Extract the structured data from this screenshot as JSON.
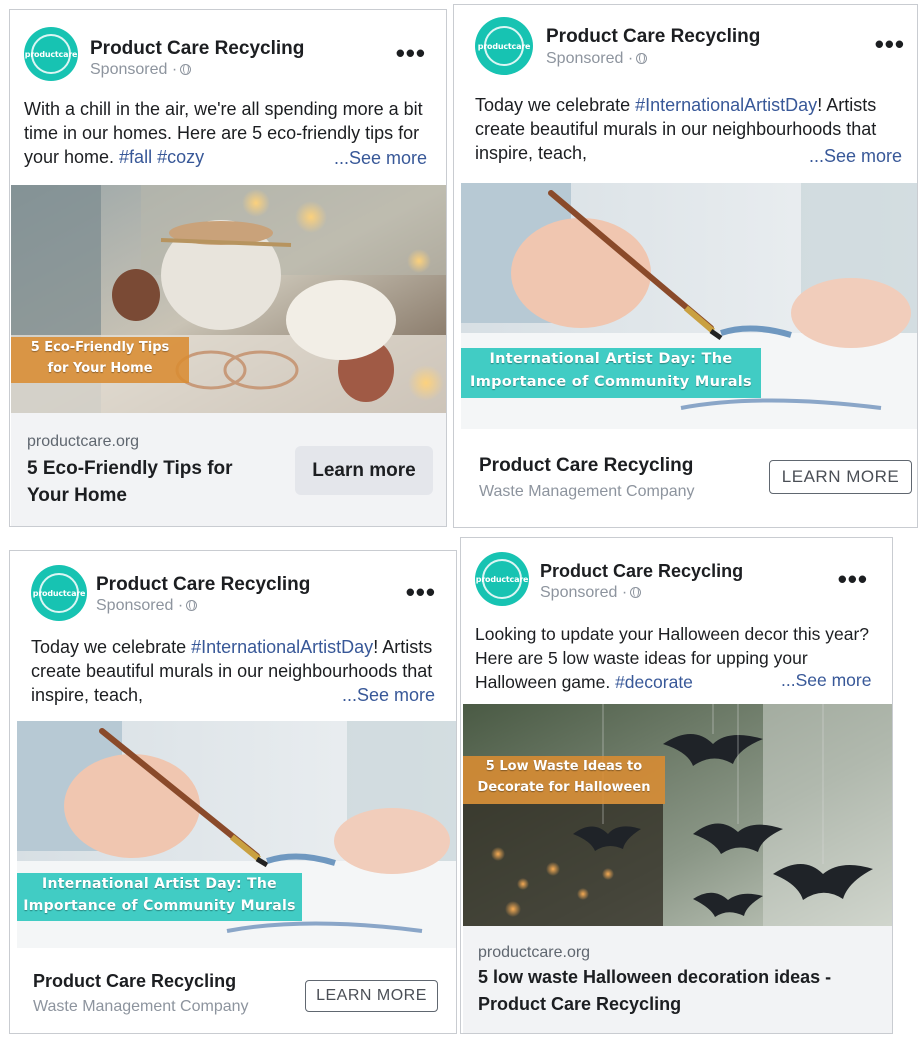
{
  "page": {
    "name": "Product Care Recycling",
    "sponsored": "Sponsored ·",
    "more_icon": "more-horizontal-icon",
    "avatar_logo": "productcare",
    "accent": "#17c3b2"
  },
  "ads": [
    {
      "body_pre": "With a chill in the air, we're all spending more a bit time in our homes. Here are 5 eco-friendly tips for your home. ",
      "hashtags": [
        "#fall",
        "#cozy"
      ],
      "see_more": "...See more",
      "image_caption": [
        "5 Eco-Friendly Tips",
        "for Your Home"
      ],
      "domain": "productcare.org",
      "title": "5 Eco-Friendly Tips for Your Home",
      "cta": "Learn more"
    },
    {
      "body_pre": "Today we celebrate ",
      "hashtag": "#InternationalArtistDay",
      "body_post": "! Artists create beautiful murals in our neighbourhoods that inspire, teach,",
      "see_more": "...See more",
      "image_caption": [
        "International Artist Day: The",
        "Importance of Community Murals"
      ],
      "title": "Product Care Recycling",
      "subtitle": "Waste Management Company",
      "cta": "LEARN MORE"
    },
    {
      "body_pre": "Today we celebrate ",
      "hashtag": "#InternationalArtistDay",
      "body_post": "! Artists create beautiful murals in our neighbourhoods that inspire, teach,",
      "see_more": "...See more",
      "image_caption": [
        "International Artist Day: The",
        "Importance of Community Murals"
      ],
      "title": "Product Care Recycling",
      "subtitle": "Waste Management Company",
      "cta": "LEARN MORE"
    },
    {
      "body_pre": "Looking to update your Halloween decor this year? Here are 5 low waste ideas for upping your Halloween game. ",
      "hashtag": "#decorate",
      "see_more": "...See more",
      "image_caption": [
        "5 Low Waste Ideas to",
        "Decorate for Halloween"
      ],
      "domain": "productcare.org",
      "title": "5 low waste Halloween decoration ideas - Product Care Recycling"
    }
  ]
}
